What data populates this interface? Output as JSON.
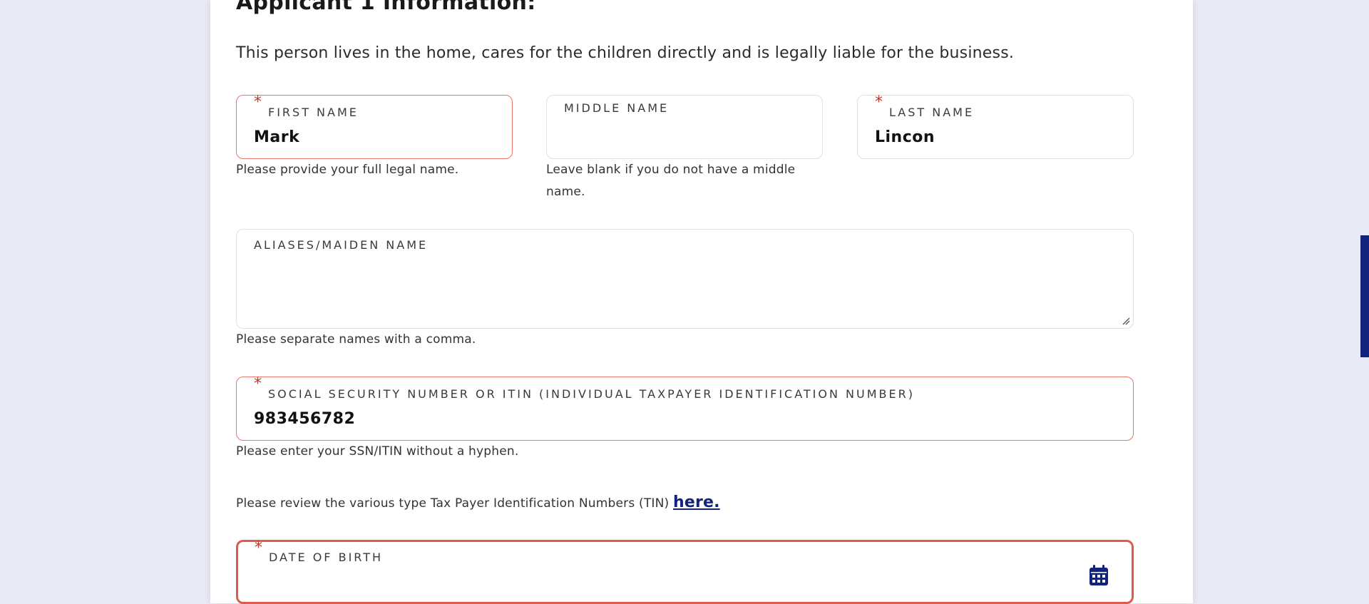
{
  "section": {
    "title": "Applicant 1 Information:",
    "intro": "This person lives in the home, cares for the children directly and is legally liable for the business."
  },
  "fields": {
    "first_name": {
      "label": "FIRST NAME",
      "value": "Mark",
      "help": "Please provide your full legal name.",
      "required": "*"
    },
    "middle_name": {
      "label": "MIDDLE NAME",
      "value": "",
      "help_line1": "Leave blank if you do not have a middle",
      "help_line2": "name."
    },
    "last_name": {
      "label": "LAST NAME",
      "value": "Lincon",
      "required": "*"
    },
    "aliases": {
      "label": "ALIASES/MAIDEN NAME",
      "value": "",
      "help": "Please separate names with a comma."
    },
    "ssn": {
      "label": "SOCIAL SECURITY NUMBER OR ITIN (INDIVIDUAL TAXPAYER IDENTIFICATION NUMBER)",
      "value": "983456782",
      "help": "Please enter your SSN/ITIN without a hyphen.",
      "required": "*"
    },
    "tin_note": {
      "text": "Please review the various type Tax Payer Identification Numbers (TIN)",
      "link": "here."
    },
    "dob": {
      "label": "DATE OF BIRTH",
      "value": "",
      "required": "*",
      "icon": "calendar-icon"
    }
  },
  "colors": {
    "accent": "#12237f",
    "required": "#c0392b",
    "error_border": "#e05a4a",
    "page_bg": "#e9eaf5"
  }
}
